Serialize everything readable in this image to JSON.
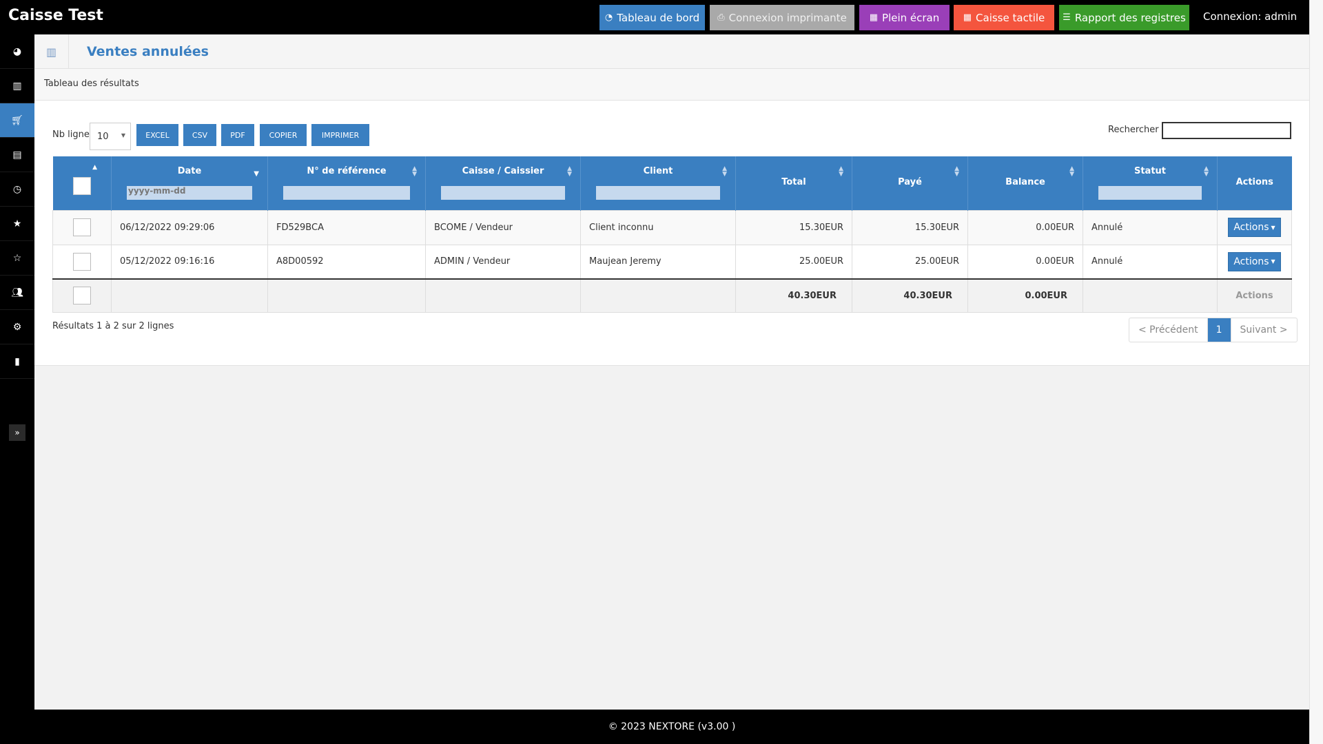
{
  "app": {
    "title": "Caisse Test"
  },
  "topbar": {
    "buttons": [
      {
        "label": "Tableau de bord",
        "icon": "dashboard-icon",
        "color": "#3a7fc1"
      },
      {
        "label": "Connexion imprimante",
        "icon": "printer-icon",
        "color": "#a9a9a9"
      },
      {
        "label": "Plein écran",
        "icon": "grid-icon",
        "color": "#9a3fb8"
      },
      {
        "label": "Caisse tactile",
        "icon": "grid-icon",
        "color": "#f4553e"
      },
      {
        "label": "Rapport des registres",
        "icon": "list-icon",
        "color": "#3a9b2a"
      }
    ],
    "login": "Connexion: admin"
  },
  "sidebar": {
    "items": [
      {
        "icon": "dashboard-icon",
        "active": false
      },
      {
        "icon": "barcode-icon",
        "active": false
      },
      {
        "icon": "cart-icon",
        "active": true
      },
      {
        "icon": "document-icon",
        "active": false
      },
      {
        "icon": "clock-icon",
        "active": false
      },
      {
        "icon": "star-icon",
        "active": false
      },
      {
        "icon": "star-outline-icon",
        "active": false
      },
      {
        "icon": "users-icon",
        "active": false
      },
      {
        "icon": "gear-icon",
        "active": false
      },
      {
        "icon": "bar-chart-icon",
        "active": false
      }
    ],
    "toggle_icon": "double-chevron-right-icon"
  },
  "page": {
    "title": "Ventes annulées",
    "panel_title": "Tableau des résultats"
  },
  "controls": {
    "nb_ligne_label": "Nb ligne",
    "nb_ligne_value": "10",
    "export_buttons": [
      "EXCEL",
      "CSV",
      "PDF",
      "COPIER",
      "IMPRIMER"
    ],
    "search_label": "Rechercher",
    "search_value": ""
  },
  "table": {
    "headers": {
      "date": "Date",
      "ref": "N° de référence",
      "caisse": "Caisse / Caissier",
      "client": "Client",
      "total": "Total",
      "paye": "Payé",
      "balance": "Balance",
      "statut": "Statut",
      "actions": "Actions"
    },
    "date_filter_placeholder": "yyyy-mm-dd",
    "rows": [
      {
        "date": "06/12/2022 09:29:06",
        "ref": "FD529BCA",
        "caisse": "BCOME / Vendeur",
        "client": "Client inconnu",
        "total": "15.30EUR",
        "paye": "15.30EUR",
        "balance": "0.00EUR",
        "statut": "Annulé",
        "action": "Actions"
      },
      {
        "date": "05/12/2022 09:16:16",
        "ref": "A8D00592",
        "caisse": "ADMIN / Vendeur",
        "client": "Maujean Jeremy",
        "total": "25.00EUR",
        "paye": "25.00EUR",
        "balance": "0.00EUR",
        "statut": "Annulé",
        "action": "Actions"
      }
    ],
    "footer": {
      "total": "40.30EUR",
      "paye": "40.30EUR",
      "balance": "0.00EUR",
      "actions": "Actions"
    }
  },
  "results_text": "Résultats 1 à 2 sur 2 lignes",
  "pagination": {
    "prev": "< Précédent",
    "current": "1",
    "next": "Suivant >"
  },
  "footer": {
    "text": "© 2023 NEXTORE (v3.00 )"
  }
}
